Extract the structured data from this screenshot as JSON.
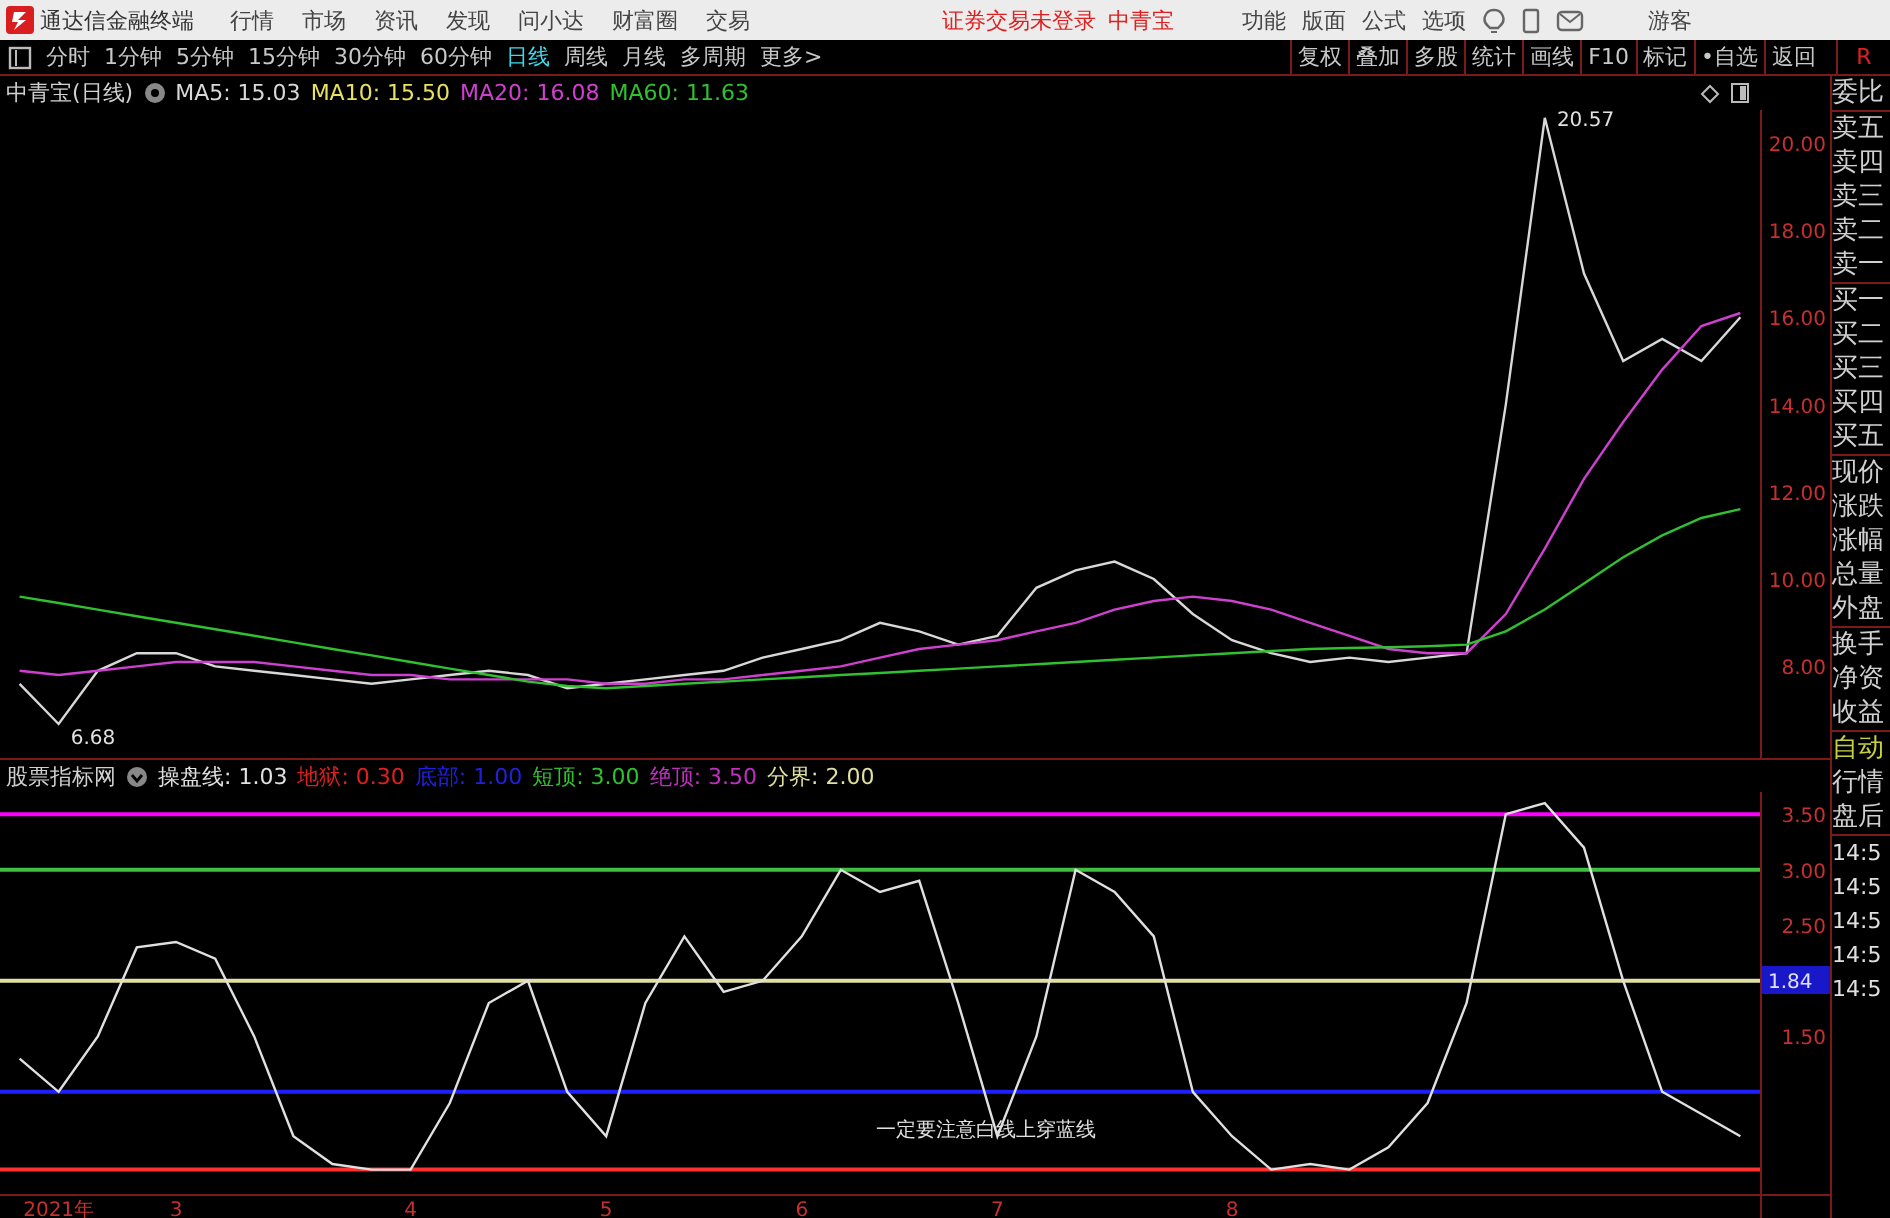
{
  "menu_bar": {
    "app_title": "通达信金融终端",
    "menu": [
      "行情",
      "市场",
      "资讯",
      "发现",
      "问小达",
      "财富圈",
      "交易"
    ],
    "notice": "证券交易未登录",
    "stock": "中青宝",
    "tools": [
      "功能",
      "版面",
      "公式",
      "选项"
    ],
    "user": "游客"
  },
  "period_tabs": [
    {
      "label": "分时",
      "selected": false
    },
    {
      "label": "1分钟",
      "selected": false
    },
    {
      "label": "5分钟",
      "selected": false
    },
    {
      "label": "15分钟",
      "selected": false
    },
    {
      "label": "30分钟",
      "selected": false
    },
    {
      "label": "60分钟",
      "selected": false
    },
    {
      "label": "日线",
      "selected": true
    },
    {
      "label": "周线",
      "selected": false
    },
    {
      "label": "月线",
      "selected": false
    },
    {
      "label": "多周期",
      "selected": false
    },
    {
      "label": "更多>",
      "selected": false
    }
  ],
  "chart_tools": [
    "复权",
    "叠加",
    "多股",
    "统计",
    "画线",
    "F10",
    "标记",
    "•自选",
    "返回"
  ],
  "corner_mark": "R",
  "price_panel": {
    "title": "中青宝(日线)",
    "legend": [
      {
        "label": "MA5: 15.03",
        "color": "#d8d8d8"
      },
      {
        "label": "MA10: 15.50",
        "color": "#e8e060"
      },
      {
        "label": "MA20: 16.08",
        "color": "#d040d0"
      },
      {
        "label": "MA60: 11.63",
        "color": "#30c030"
      }
    ],
    "chart_data": {
      "type": "line",
      "ylim": [
        5.9,
        20.75
      ],
      "yticks": [
        {
          "value": 8,
          "label": "8.00"
        },
        {
          "value": 10,
          "label": "10.00"
        },
        {
          "value": 12,
          "label": "12.00"
        },
        {
          "value": 14,
          "label": "14.00"
        },
        {
          "value": 16,
          "label": "16.00"
        },
        {
          "value": 18,
          "label": "18.00"
        },
        {
          "value": 20,
          "label": "20.00"
        }
      ],
      "categories": [
        null,
        null,
        null,
        null,
        null,
        null,
        null,
        null,
        null,
        null,
        null,
        null,
        null,
        null,
        null,
        null,
        null,
        null,
        null,
        null,
        null,
        null,
        null,
        null,
        null,
        null,
        null,
        null,
        null,
        null,
        null,
        null,
        null,
        null,
        null,
        null,
        null,
        null,
        null,
        null,
        null,
        null,
        null,
        null,
        null
      ],
      "series": [
        {
          "color": "#d8d8d8",
          "values": [
            7.6,
            6.68,
            7.9,
            8.3,
            8.3,
            8.0,
            7.9,
            7.8,
            7.7,
            7.6,
            7.7,
            7.8,
            7.9,
            7.8,
            7.5,
            7.6,
            7.7,
            7.8,
            7.9,
            8.2,
            8.4,
            8.6,
            9.0,
            8.8,
            8.5,
            8.7,
            9.8,
            10.2,
            10.4,
            10.0,
            9.2,
            8.6,
            8.3,
            8.1,
            8.2,
            8.1,
            8.2,
            8.3,
            14.0,
            20.57,
            17.0,
            15.0,
            15.5,
            15.0,
            16.0
          ]
        },
        {
          "color": "#d040d0",
          "values": [
            7.9,
            7.8,
            7.9,
            8.0,
            8.1,
            8.1,
            8.1,
            8.0,
            7.9,
            7.8,
            7.8,
            7.7,
            7.7,
            7.7,
            7.7,
            7.6,
            7.6,
            7.7,
            7.7,
            7.8,
            7.9,
            8.0,
            8.2,
            8.4,
            8.5,
            8.6,
            8.8,
            9.0,
            9.3,
            9.5,
            9.6,
            9.5,
            9.3,
            9.0,
            8.7,
            8.4,
            8.3,
            8.3,
            9.2,
            10.7,
            12.3,
            13.6,
            14.8,
            15.8,
            16.1
          ]
        },
        {
          "color": "#30c030",
          "values": [
            9.6,
            9.45,
            9.3,
            9.15,
            9.0,
            8.85,
            8.7,
            8.55,
            8.4,
            8.25,
            8.1,
            7.95,
            7.8,
            7.65,
            7.55,
            7.5,
            7.55,
            7.6,
            7.65,
            7.7,
            7.75,
            7.8,
            7.85,
            7.9,
            7.95,
            8.0,
            8.05,
            8.1,
            8.15,
            8.2,
            8.25,
            8.3,
            8.35,
            8.4,
            8.42,
            8.44,
            8.46,
            8.5,
            8.8,
            9.3,
            9.9,
            10.5,
            11.0,
            11.4,
            11.6
          ]
        }
      ],
      "annotations": [
        "20.57",
        "6.68"
      ]
    }
  },
  "indicator_panel": {
    "title": "股票指标网",
    "legend": [
      {
        "label": "操盘线: 1.03",
        "color": "#e0e0e0"
      },
      {
        "label": "地狱: 0.30",
        "color": "#e02020"
      },
      {
        "label": "底部: 1.00",
        "color": "#2020e0"
      },
      {
        "label": "短顶: 3.00",
        "color": "#30c030"
      },
      {
        "label": "绝顶: 3.50",
        "color": "#c030c0"
      },
      {
        "label": "分界: 2.00",
        "color": "#e0e0a0"
      }
    ],
    "current_value": "1.84",
    "chart_data": {
      "type": "line",
      "ylim": [
        0.08,
        3.7
      ],
      "yticks": [
        {
          "value": 1.5,
          "label": "1.50"
        },
        {
          "value": 2.5,
          "label": "2.50"
        },
        {
          "value": 3,
          "label": "3.00"
        },
        {
          "value": 3.5,
          "label": "3.50"
        }
      ],
      "categories": [
        null,
        "2021年",
        null,
        null,
        "3",
        null,
        null,
        null,
        null,
        null,
        "4",
        null,
        null,
        null,
        null,
        "5",
        null,
        null,
        null,
        null,
        "6",
        null,
        null,
        null,
        null,
        "7",
        null,
        null,
        null,
        null,
        null,
        "8",
        null,
        null,
        null,
        null,
        null,
        null,
        null,
        null,
        null,
        null,
        null,
        null,
        null
      ],
      "ref_lines": [
        {
          "axis": "y",
          "value": 3.5,
          "color": "#ff00ff"
        },
        {
          "axis": "y",
          "value": 3,
          "color": "#40c040"
        },
        {
          "axis": "y",
          "value": 2,
          "color": "#e0e0a0"
        },
        {
          "axis": "y",
          "value": 1,
          "color": "#2020ff"
        },
        {
          "axis": "y",
          "value": 0.3,
          "color": "#ff3030"
        }
      ],
      "series": [
        {
          "color": "#e0e0e0",
          "values": [
            1.3,
            1.0,
            1.5,
            2.3,
            2.35,
            2.2,
            1.5,
            0.6,
            0.35,
            0.3,
            0.3,
            0.9,
            1.8,
            2.0,
            1.0,
            0.6,
            1.8,
            2.4,
            1.9,
            2.0,
            2.4,
            3.0,
            2.8,
            2.9,
            1.8,
            0.6,
            1.5,
            3.0,
            2.8,
            2.4,
            1.0,
            0.6,
            0.3,
            0.35,
            0.3,
            0.5,
            0.9,
            1.8,
            3.5,
            3.6,
            3.2,
            2.0,
            1.0,
            0.8,
            0.6
          ]
        }
      ],
      "annotations": [
        "一定要注意白线上穿蓝线"
      ]
    }
  },
  "quote_panel": {
    "groups": [
      [
        "委比"
      ],
      [
        "卖五",
        "卖四",
        "卖三",
        "卖二",
        "卖一"
      ],
      [
        "买一",
        "买二",
        "买三",
        "买四",
        "买五"
      ],
      [
        "现价",
        "涨跌",
        "涨幅",
        "总量",
        "外盘"
      ],
      [
        "换手",
        "净资",
        "收益"
      ]
    ],
    "modes": [
      "自动",
      "行情",
      "盘后"
    ],
    "times": [
      "14:5",
      "14:5",
      "14:5",
      "14:5",
      "14:5"
    ]
  }
}
